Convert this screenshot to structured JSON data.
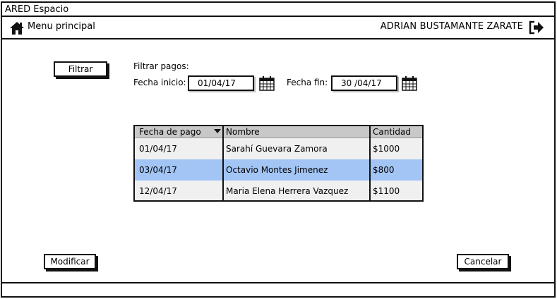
{
  "window": {
    "title": "ARED Espacio"
  },
  "nav": {
    "menu_label": "Menu principal",
    "user_name": "ADRIAN BUSTAMANTE ZARATE"
  },
  "filter": {
    "button_label": "Filtrar",
    "heading": "Filtrar pagos:",
    "start_label": "Fecha inicio:",
    "start_value": "01/04/17",
    "end_label": "Fecha fin:",
    "end_value": "30 /04/17"
  },
  "table": {
    "columns": [
      "Fecha de pago",
      "Nombre",
      "Cantidad"
    ],
    "rows": [
      [
        "01/04/17",
        "Sarahí Guevara Zamora",
        "$1000"
      ],
      [
        "03/04/17",
        "Octavio Montes Jimenez",
        "$800"
      ],
      [
        "12/04/17",
        "Maria Elena Herrera Vazquez",
        "$1100"
      ]
    ],
    "selected_row": 2
  },
  "actions": {
    "modify_label": "Modificar",
    "cancel_label": "Cancelar"
  },
  "icons": {
    "home": "home-icon",
    "logout": "logout-icon",
    "calendar": "calendar-icon",
    "sort": "sort-desc-icon"
  },
  "colors": {
    "selected_row": "#a3c5f5",
    "header_bg": "#c8c8c8",
    "row_bg": "#f0f0f0"
  }
}
